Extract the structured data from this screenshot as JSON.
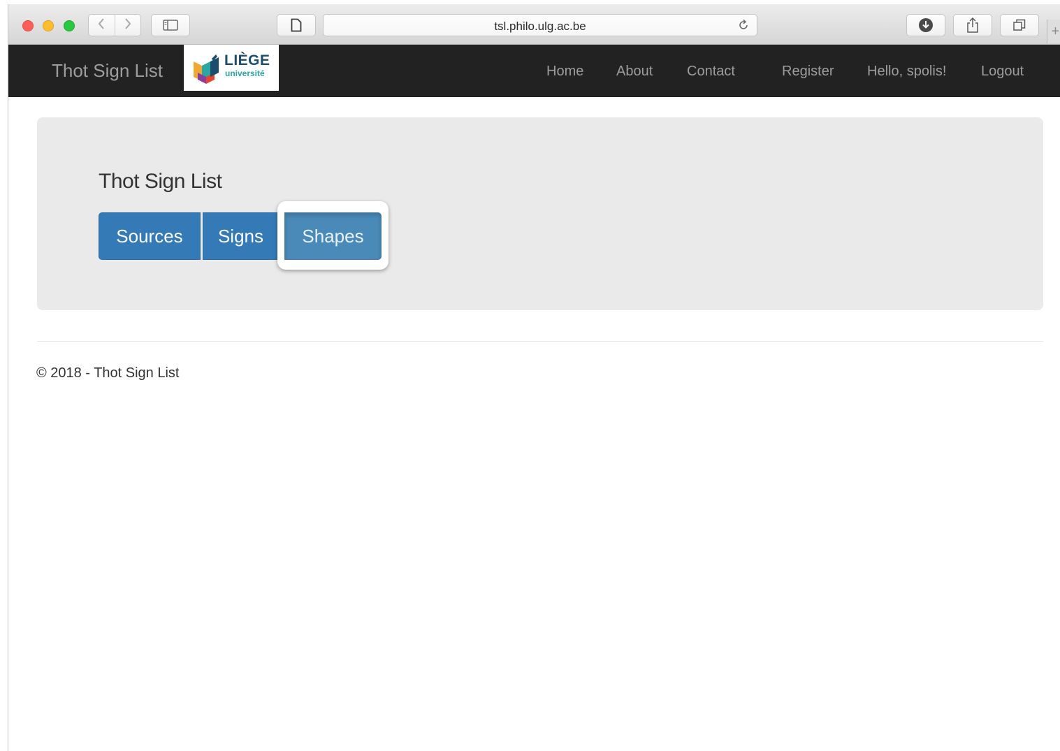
{
  "browser": {
    "url": "tsl.philo.ulg.ac.be",
    "back_icon": "chevron-left-icon",
    "forward_icon": "chevron-right-icon",
    "new_tab_label": "+"
  },
  "navbar": {
    "brand": "Thot Sign List",
    "logo": {
      "name": "LIÈGE",
      "sub": "université"
    },
    "links": [
      "Home",
      "About",
      "Contact",
      "Register",
      "Hello, spolis!",
      "Logout"
    ]
  },
  "jumbotron": {
    "title": "Thot Sign List",
    "buttons": [
      "Sources",
      "Signs",
      "Shapes"
    ]
  },
  "footer": {
    "text": "© 2018 - Thot Sign List"
  },
  "colors": {
    "navbar": "#222222",
    "primary": "#337ab7",
    "jumbotron": "#eaeaea"
  }
}
